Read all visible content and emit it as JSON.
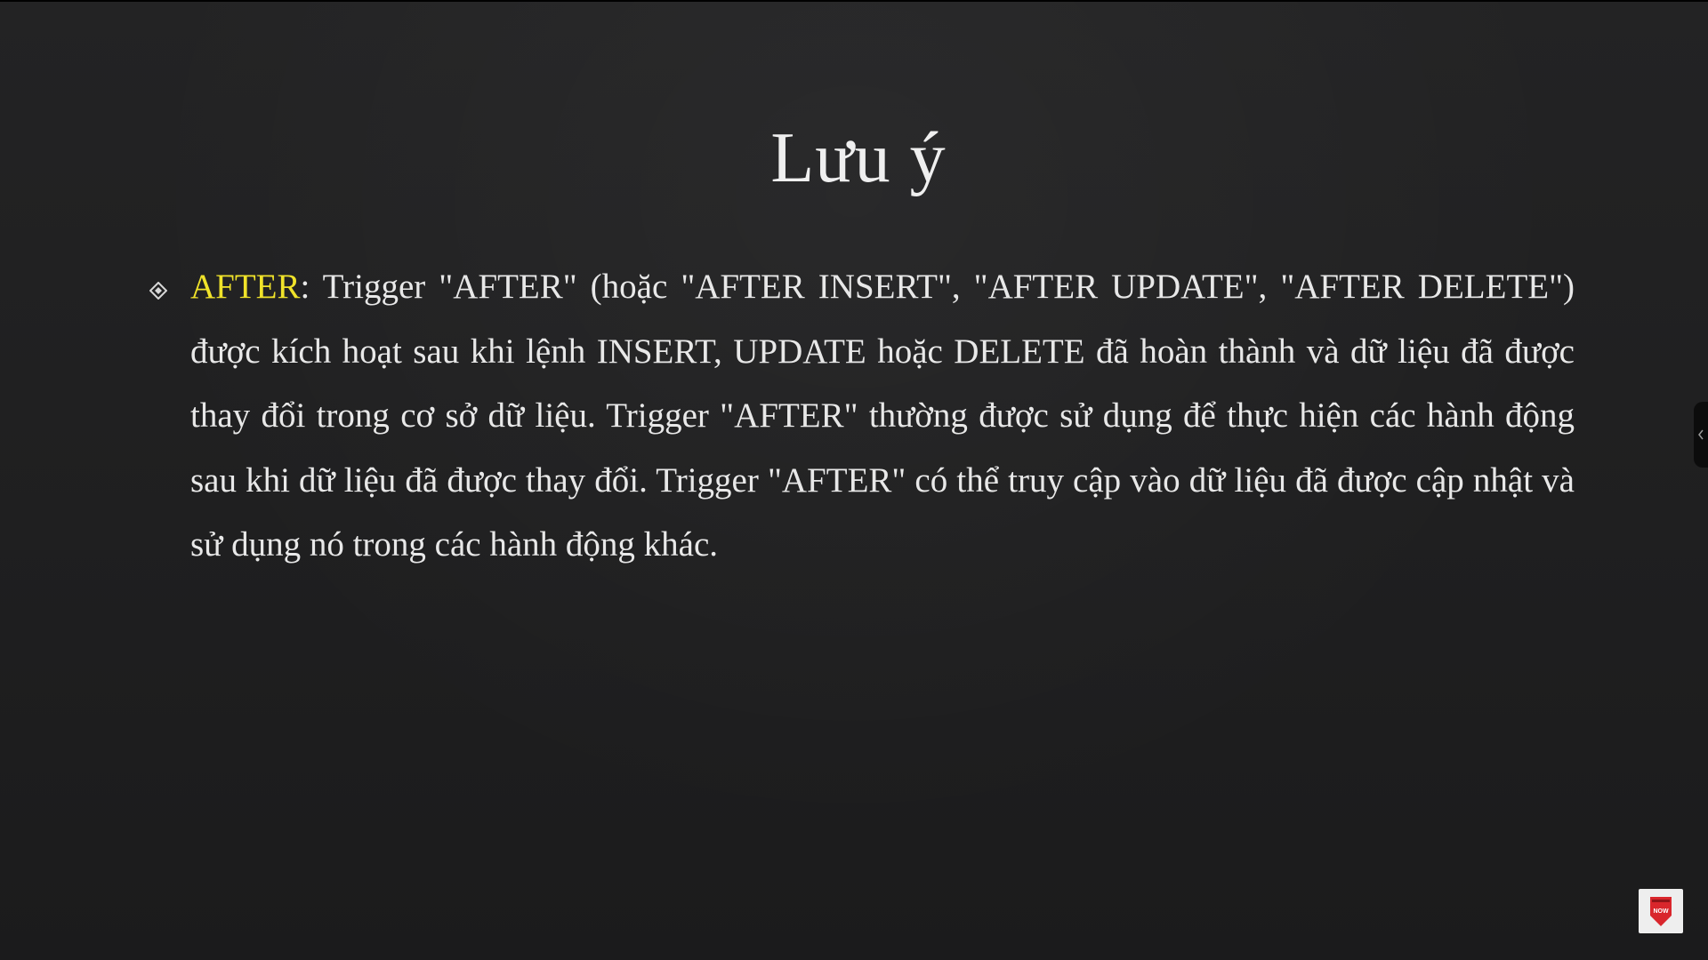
{
  "slide": {
    "title": "Lưu ý",
    "bullet": {
      "keyword": "AFTER",
      "text": ": Trigger \"AFTER\" (hoặc \"AFTER INSERT\", \"AFTER UPDATE\", \"AFTER DELETE\") được kích hoạt sau khi lệnh INSERT, UPDATE hoặc DELETE đã hoàn thành và dữ liệu đã được thay đổi trong cơ sở dữ liệu. Trigger \"AFTER\" thường được sử dụng để thực hiện các hành động sau khi dữ liệu đã được thay đổi. Trigger \"AFTER\" có thể truy cập vào dữ liệu đã được cập nhật và sử dụng nó trong các hành động khác.",
      "icon": "diamond-bullet-icon"
    }
  },
  "overlay": {
    "side_tab_icon": "chevron-left-icon",
    "badge_icon": "shield-badge-icon",
    "badge_text": "NOW"
  },
  "colors": {
    "background": "#1f1f20",
    "text": "#e8e8e8",
    "keyword": "#f0e32a",
    "badge_red": "#d9262c"
  }
}
